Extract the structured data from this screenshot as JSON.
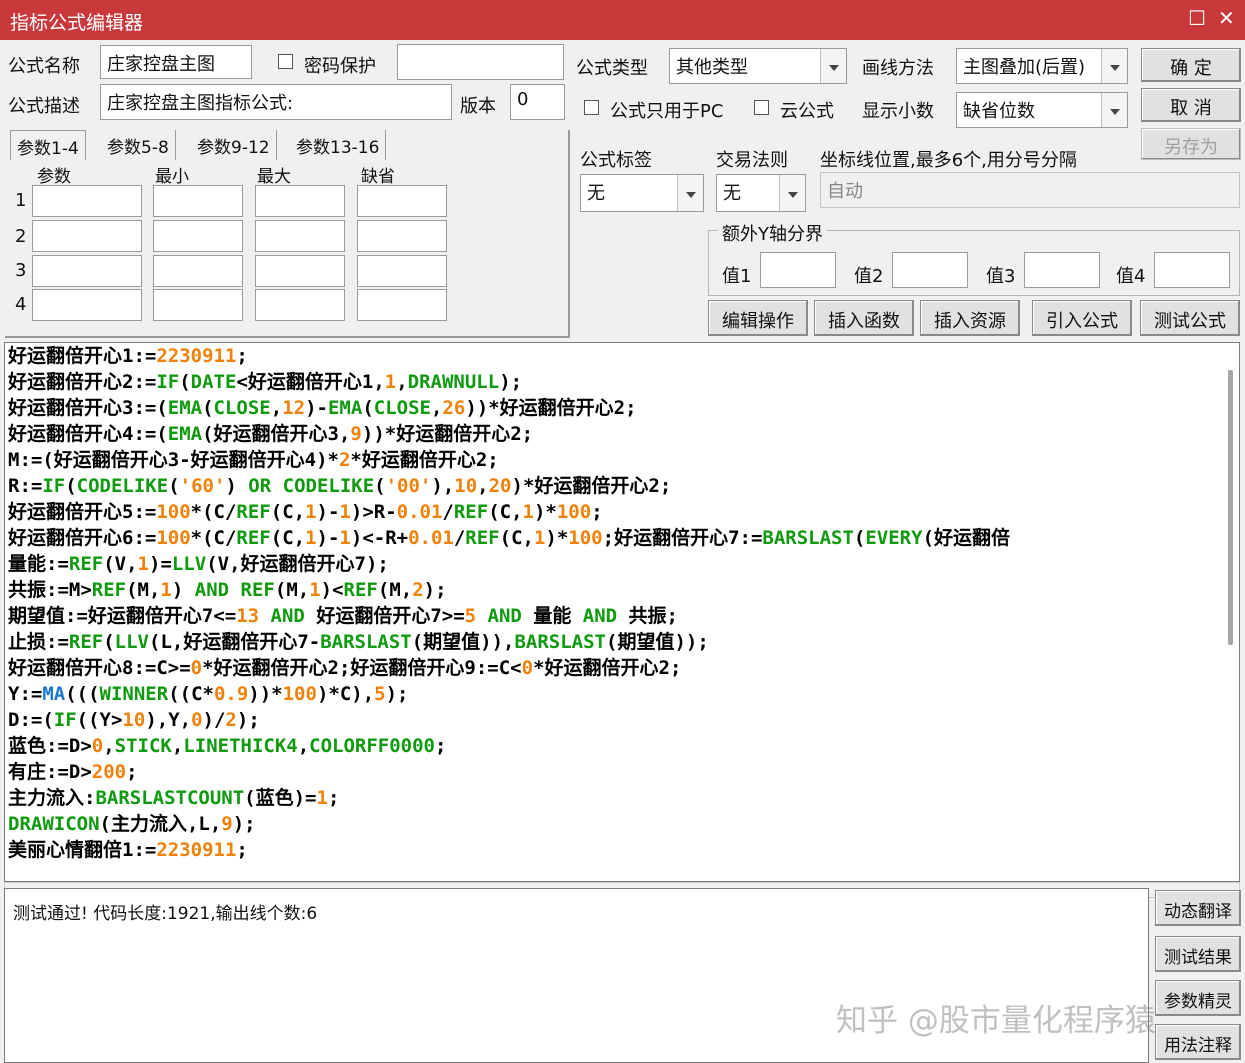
{
  "window": {
    "title": "指标公式编辑器",
    "maximize_glyph": "☐",
    "close_glyph": "✕"
  },
  "form": {
    "name_label": "公式名称",
    "name_value": "庄家控盘主图",
    "password_label": "密码保护",
    "desc_label": "公式描述",
    "desc_value": "庄家控盘主图指标公式:",
    "version_label": "版本",
    "version_value": "0",
    "type_label": "公式类型",
    "type_value": "其他类型",
    "draw_label": "画线方法",
    "draw_value": "主图叠加(后置)",
    "pc_only_label": "公式只用于PC",
    "cloud_label": "云公式",
    "decimals_label": "显示小数",
    "decimals_value": "缺省位数",
    "tag_label": "公式标签",
    "tag_value": "无",
    "trade_label": "交易法则",
    "trade_value": "无",
    "axis_label": "坐标线位置,最多6个,用分号分隔",
    "axis_value": "自动",
    "yaxis_group_label": "额外Y轴分界",
    "yaxis_values": [
      "值1",
      "值2",
      "值3",
      "值4"
    ]
  },
  "buttons": {
    "ok": "确  定",
    "cancel": "取  消",
    "save_as": "另存为",
    "edit_ops": "编辑操作",
    "insert_func": "插入函数",
    "insert_res": "插入资源",
    "import_formula": "引入公式",
    "test_formula": "测试公式",
    "dynamic_translate": "动态翻译",
    "test_result": "测试结果",
    "param_wizard": "参数精灵",
    "usage_note": "用法注释"
  },
  "params": {
    "tabs": [
      "参数1-4",
      "参数5-8",
      "参数9-12",
      "参数13-16"
    ],
    "headers": [
      "参数",
      "最小",
      "最大",
      "缺省"
    ],
    "rows": [
      "1",
      "2",
      "3",
      "4"
    ]
  },
  "result": {
    "text": "测试通过! 代码长度:1921,输出线个数:6"
  },
  "watermark": "知乎 @股市量化程序猿"
}
